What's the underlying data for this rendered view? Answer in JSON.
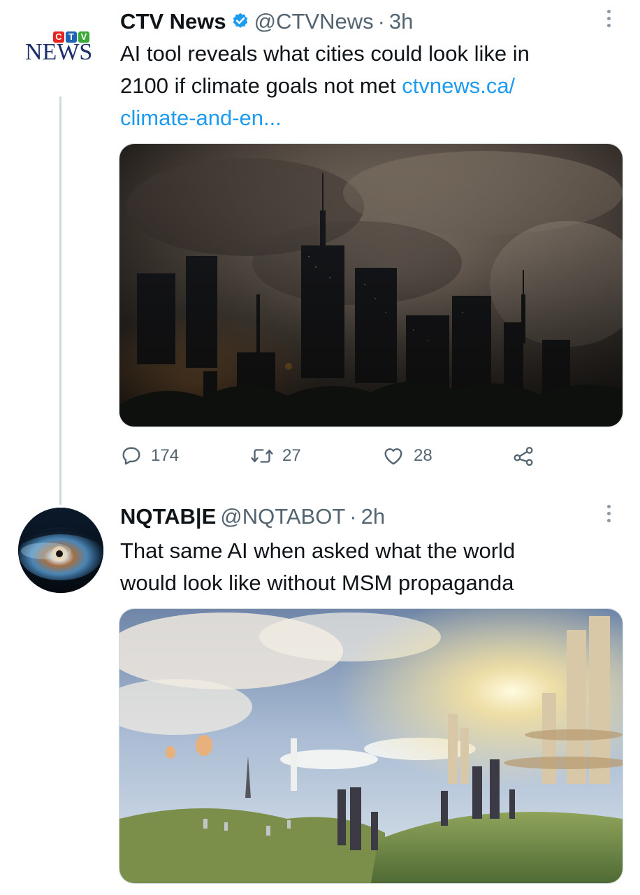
{
  "tweet1": {
    "display_name": "CTV News",
    "handle": "@CTVNews",
    "separator": "·",
    "time": "3h",
    "logo_letters": [
      "C",
      "T",
      "V"
    ],
    "logo_word": "NEWS",
    "text_line1": "AI tool reveals what cities could look like in",
    "text_line2_plain": "2100 if climate goals not met ",
    "text_link_part1": "ctvnews.ca/",
    "text_link_part2": "climate-and-en...",
    "image_icon": "smoky-city-skyline-image",
    "actions": {
      "replies": "174",
      "retweets": "27",
      "likes": "28",
      "reply_icon": "reply-icon",
      "retweet_icon": "retweet-icon",
      "like_icon": "heart-icon",
      "share_icon": "share-icon"
    }
  },
  "tweet2": {
    "display_name": "NQTAB|E",
    "handle": "@NQTABOT",
    "separator": "·",
    "time": "2h",
    "text_line1": "That same AI when asked what the world",
    "text_line2": "would look like without MSM propaganda",
    "image_icon": "utopian-city-image"
  },
  "colors": {
    "text": "#0f1419",
    "secondary": "#536471",
    "link": "#1d9bf0",
    "verified": "#1d9bf0",
    "thread_line": "#cfd9de",
    "ctv_red": "#e52421",
    "ctv_blue": "#1f64b2",
    "ctv_green": "#3aa935",
    "news_navy": "#1d2f6b"
  }
}
